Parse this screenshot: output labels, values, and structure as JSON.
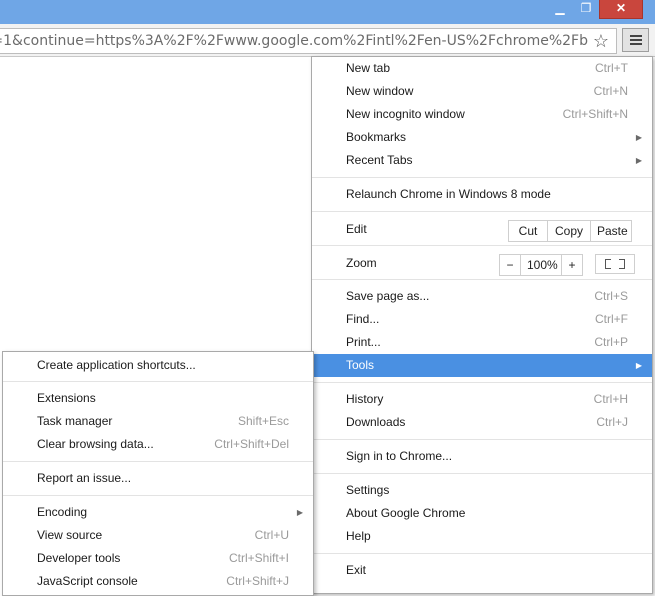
{
  "window": {
    "controls": {
      "minimize": "▁",
      "maximize": "❐",
      "close": "✕"
    }
  },
  "omnibox": {
    "url_visible": "=1&continue=https%3A%2F%2Fwww.google.com%2Fintl%2Fen-US%2Fchrome%2Fb",
    "star_glyph": "☆"
  },
  "menu": {
    "new_tab": {
      "label": "New tab",
      "shortcut": "Ctrl+T"
    },
    "new_window": {
      "label": "New window",
      "shortcut": "Ctrl+N"
    },
    "new_incognito": {
      "label": "New incognito window",
      "shortcut": "Ctrl+Shift+N"
    },
    "bookmarks": {
      "label": "Bookmarks"
    },
    "recent_tabs": {
      "label": "Recent Tabs"
    },
    "relaunch": {
      "label": "Relaunch Chrome in Windows 8 mode"
    },
    "edit": {
      "label": "Edit",
      "cut": "Cut",
      "copy": "Copy",
      "paste": "Paste"
    },
    "zoom": {
      "label": "Zoom",
      "minus": "−",
      "level": "100%",
      "plus": "+"
    },
    "save_page": {
      "label": "Save page as...",
      "shortcut": "Ctrl+S"
    },
    "find": {
      "label": "Find...",
      "shortcut": "Ctrl+F"
    },
    "print": {
      "label": "Print...",
      "shortcut": "Ctrl+P"
    },
    "tools": {
      "label": "Tools"
    },
    "history": {
      "label": "History",
      "shortcut": "Ctrl+H"
    },
    "downloads": {
      "label": "Downloads",
      "shortcut": "Ctrl+J"
    },
    "sign_in": {
      "label": "Sign in to Chrome..."
    },
    "settings": {
      "label": "Settings"
    },
    "about": {
      "label": "About Google Chrome"
    },
    "help": {
      "label": "Help"
    },
    "exit": {
      "label": "Exit"
    }
  },
  "submenu": {
    "create_shortcuts": {
      "label": "Create application shortcuts..."
    },
    "extensions": {
      "label": "Extensions"
    },
    "task_manager": {
      "label": "Task manager",
      "shortcut": "Shift+Esc"
    },
    "clear_browsing": {
      "label": "Clear browsing data...",
      "shortcut": "Ctrl+Shift+Del"
    },
    "report_issue": {
      "label": "Report an issue..."
    },
    "encoding": {
      "label": "Encoding"
    },
    "view_source": {
      "label": "View source",
      "shortcut": "Ctrl+U"
    },
    "developer_tools": {
      "label": "Developer tools",
      "shortcut": "Ctrl+Shift+I"
    },
    "js_console": {
      "label": "JavaScript console",
      "shortcut": "Ctrl+Shift+J"
    }
  },
  "colors": {
    "titlebar": "#6fa6e6",
    "highlight": "#4a90e2",
    "close_button": "#c9463d"
  },
  "icons": {
    "arrow": "▶"
  }
}
